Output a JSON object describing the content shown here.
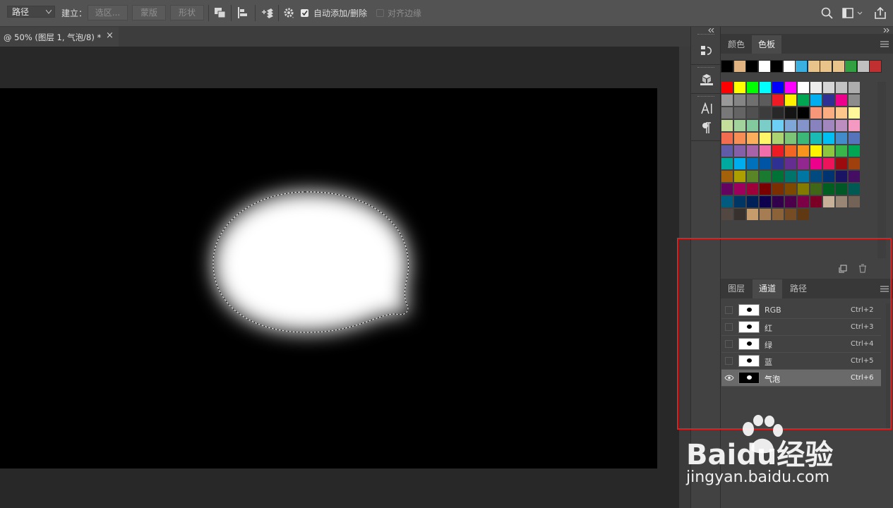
{
  "options_bar": {
    "tool_mode": "路径",
    "make_label": "建立：",
    "selection_button": "选区...",
    "mask_button": "蒙版",
    "shape_button": "形状",
    "auto_add_delete_label": "自动添加/删除",
    "align_edges_label": "对齐边缘",
    "search_icon": "search-icon",
    "workspace_icon": "workspace-icon",
    "share_icon": "share-icon"
  },
  "document_tab": {
    "title": "@ 50% (图层 1, 气泡/8) *",
    "close_glyph": "×"
  },
  "swatches_panel": {
    "tabs": [
      "颜色",
      "色板"
    ],
    "active_tab": "色板",
    "recent": [
      "#000000",
      "#e0b380",
      "#000000",
      "#ffffff",
      "#000000",
      "#ffffff",
      "#3ab0e0",
      "#e8c48a",
      "#e8c48a",
      "#e8c48a",
      "#30a040",
      "#c0c0c0",
      "#c03030"
    ],
    "grid": [
      [
        "#ff0000",
        "#ffff00",
        "#00ff00",
        "#00ffff",
        "#0000ff",
        "#ff00ff",
        "#ffffff",
        "#ebebeb",
        "#d6d6d6",
        "#c2c2c2",
        "#adadad"
      ],
      [
        "#999999",
        "#858585",
        "#707070",
        "#5c5c5c",
        "#ed1c24",
        "#fff200",
        "#00a651",
        "#00aeef",
        "#2e3192",
        "#ec008c",
        "#8c8c8c"
      ],
      [
        "#787878",
        "#646464",
        "#505050",
        "#3c3c3c",
        "#282828",
        "#141414",
        "#000000",
        "#f7977a",
        "#f9ad81",
        "#fdc68a",
        "#fff79a"
      ],
      [
        "#c4df9b",
        "#a3d39c",
        "#82ca9d",
        "#7bcdc8",
        "#6ecff6",
        "#7ea7d8",
        "#8493ca",
        "#8882be",
        "#a187be",
        "#bc8dbf",
        "#f49ac2"
      ],
      [
        "#f26c4f",
        "#f68e56",
        "#fbaf5d",
        "#fff568",
        "#acd372",
        "#7cc576",
        "#3bb878",
        "#1abbb4",
        "#00bff3",
        "#438ccb",
        "#5574b9"
      ],
      [
        "#605ca8",
        "#855fa8",
        "#a763a8",
        "#f06ea9",
        "#ed1c24",
        "#f26522",
        "#f7941d",
        "#fff200",
        "#8dc73f",
        "#39b54a",
        "#00a651"
      ],
      [
        "#00a99d",
        "#00aeef",
        "#0072bc",
        "#0054a6",
        "#2e3192",
        "#662d91",
        "#92278f",
        "#ec008c",
        "#ed145b",
        "#9e0b0f",
        "#a0410d"
      ],
      [
        "#a36209",
        "#aba000",
        "#598527",
        "#1a7b30",
        "#007236",
        "#00746b",
        "#0076a3",
        "#004a80",
        "#003471",
        "#1b1464",
        "#440e62"
      ],
      [
        "#630460",
        "#9e005d",
        "#9e0039",
        "#790000",
        "#7b2e00",
        "#7d4900",
        "#827b00",
        "#406618",
        "#005e20",
        "#005826",
        "#005952"
      ],
      [
        "#005b7f",
        "#003663",
        "#002157",
        "#0d004c",
        "#32004b",
        "#4b0049",
        "#7b0046",
        "#7a0026",
        "#c7b299",
        "#998675",
        "#736357"
      ],
      [
        "#534741",
        "#37302d",
        "#c69c6d",
        "#a67c52",
        "#8c6239",
        "#754c24",
        "#603913"
      ]
    ]
  },
  "channels_panel": {
    "tabs": [
      "图层",
      "通道",
      "路径"
    ],
    "active_tab": "通道",
    "rows": [
      {
        "name": "RGB",
        "shortcut": "Ctrl+2",
        "selected": false
      },
      {
        "name": "红",
        "shortcut": "Ctrl+3",
        "selected": false
      },
      {
        "name": "绿",
        "shortcut": "Ctrl+4",
        "selected": false
      },
      {
        "name": "蓝",
        "shortcut": "Ctrl+5",
        "selected": false
      },
      {
        "name": "气泡",
        "shortcut": "Ctrl+6",
        "selected": true
      }
    ]
  },
  "watermark": {
    "brand": "Baidu经验",
    "url": "jingyan.baidu.com"
  },
  "highlight_color": "#e02020"
}
